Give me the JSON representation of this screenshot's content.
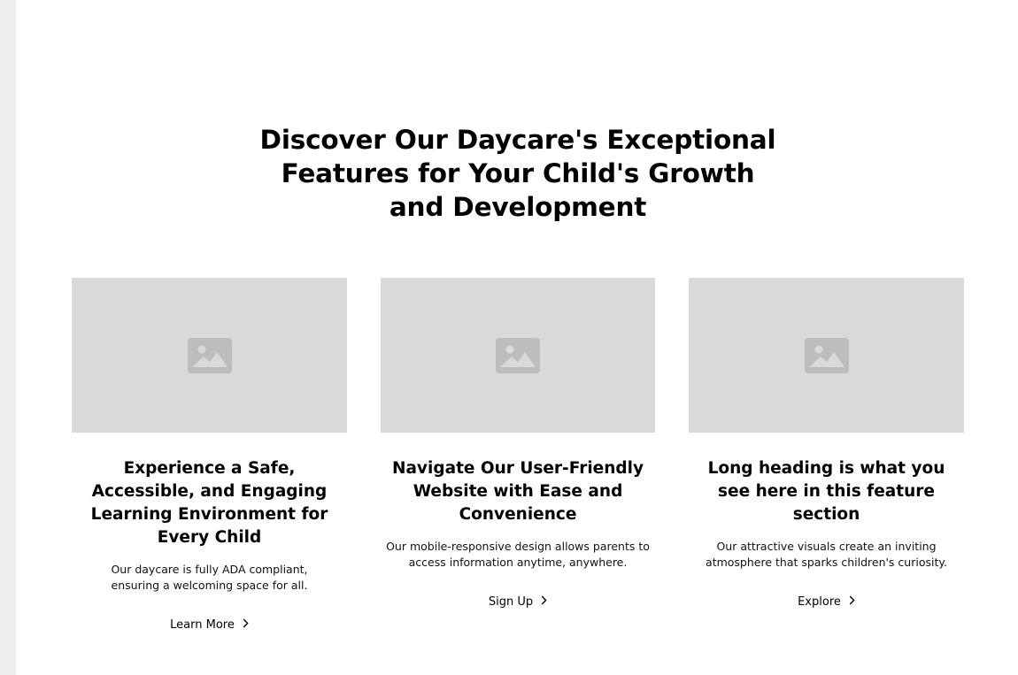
{
  "section": {
    "title": "Discover Our Daycare's Exceptional Features for Your Child's Growth and Development"
  },
  "cards": [
    {
      "image_icon": "image-placeholder-icon",
      "heading": "Experience a Safe, Accessible, and Engaging Learning Environment for Every Child",
      "text": "Our daycare is fully ADA compliant, ensuring a welcoming space for all.",
      "link_label": "Learn More",
      "link_icon": "chevron-right-icon"
    },
    {
      "image_icon": "image-placeholder-icon",
      "heading": "Navigate Our User-Friendly Website with Ease and Convenience",
      "text": "Our mobile-responsive design allows parents to access information anytime, anywhere.",
      "link_label": "Sign Up",
      "link_icon": "chevron-right-icon"
    },
    {
      "image_icon": "image-placeholder-icon",
      "heading": "Long heading is what you see here in this feature section",
      "text": "Our attractive visuals create an inviting atmosphere that sparks children's curiosity.",
      "link_label": "Explore",
      "link_icon": "chevron-right-icon"
    }
  ],
  "colors": {
    "rail": "#efeeec",
    "placeholder": "#d9d9d9",
    "placeholder_icon": "#bdbdbd"
  }
}
